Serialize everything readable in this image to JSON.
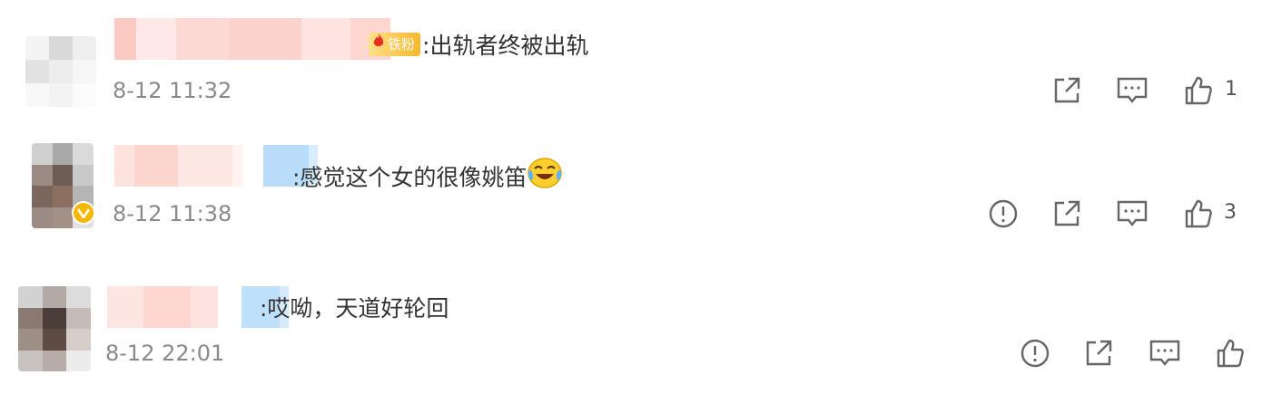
{
  "comments": [
    {
      "badge_text": "铁粉",
      "text": ":出轨者终被出轨",
      "time": "8-12 11:32",
      "like_count": "1"
    },
    {
      "text": ":感觉这个女的很像姚笛",
      "emoji_icon": "laughing-crying-emoji",
      "time": "8-12 11:38",
      "like_count": "3",
      "verified": true
    },
    {
      "text": ":哎呦，天道好轮回",
      "time": "8-12 22:01",
      "like_count": ""
    }
  ],
  "icons": {
    "report": "exclamation-circle-icon",
    "share": "share-icon",
    "reply": "comment-icon",
    "like": "thumbs-up-icon"
  },
  "colors": {
    "text": "#333333",
    "time": "#8a8a8a",
    "icon": "#666666",
    "verified": "#f5b800"
  }
}
